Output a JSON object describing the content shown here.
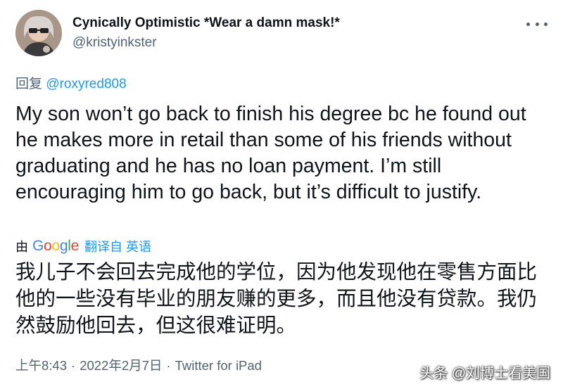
{
  "author": {
    "display_name": "Cynically Optimistic *Wear a damn mask!*",
    "handle": "@kristyinkster",
    "avatar_icon": "profile-photo"
  },
  "more_icon": "more-options-icon",
  "reply": {
    "prefix": "回复",
    "mention": "@roxyred808"
  },
  "tweet_text": "My son won’t go back to finish his degree bc he found out he makes more in retail than some of his friends without graduating and he has no loan payment. I’m still encouraging him to go back, but it’s difficult to justify.",
  "translation": {
    "by_label": "由",
    "google_letters": [
      "G",
      "o",
      "o",
      "g",
      "l",
      "e"
    ],
    "action_label": "翻译自 英语",
    "translated_text": "我儿子不会回去完成他的学位，因为他发现他在零售方面比他的一些没有毕业的朋友赚的更多，而且他没有贷款。我仍然鼓励他回去，但这很难证明。"
  },
  "meta": {
    "time": "上午8:43",
    "separator": "·",
    "date": "2022年2月7日",
    "source": "Twitter for iPad"
  },
  "watermark": "头条 @刘博士看美国",
  "colors": {
    "text_primary": "#0f1419",
    "text_secondary": "#536471",
    "link": "#1d9bf0"
  }
}
